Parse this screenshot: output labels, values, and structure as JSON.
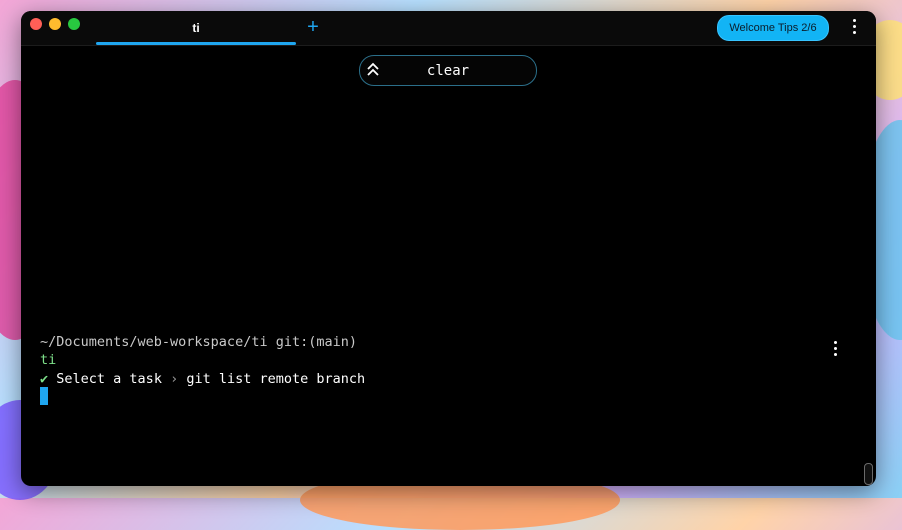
{
  "tabs": [
    {
      "label": "ti",
      "active": true
    }
  ],
  "new_tab_label": "+",
  "header": {
    "tips_label": "Welcome Tips 2/6"
  },
  "history": {
    "command": "clear"
  },
  "block": {
    "prompt": "~/Documents/web-workspace/ti git:(main)",
    "command": "ti",
    "task_check": "✔",
    "task_label": "Select a task",
    "task_arrow": "›",
    "task_value": "git list remote branch"
  },
  "colors": {
    "accent": "#1fa6f0",
    "tips_button": "#12b4f5",
    "command_green": "#7ee08a",
    "background": "#000000"
  },
  "icons": [
    "close-light",
    "minimize-light",
    "zoom-light",
    "plus-icon",
    "kebab-icon",
    "double-chevron-up-icon"
  ]
}
